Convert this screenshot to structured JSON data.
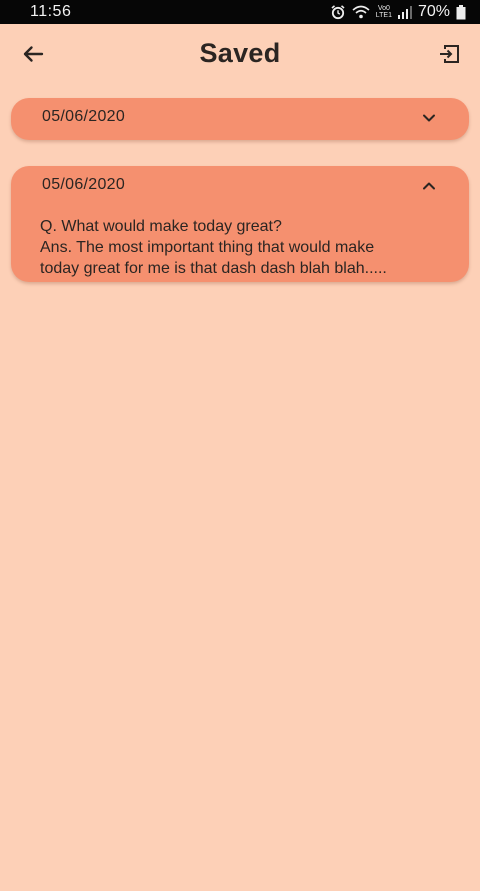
{
  "status_bar": {
    "time": "11:56",
    "network_top": "Vo0",
    "network_bottom": "LTE1",
    "battery": "70%"
  },
  "header": {
    "title": "Saved",
    "back_icon": "arrow-left-icon",
    "exit_icon": "logout-icon"
  },
  "entries": [
    {
      "date": "05/06/2020",
      "expanded": false,
      "toggle_icon": "chevron-down-icon"
    },
    {
      "date": "05/06/2020",
      "expanded": true,
      "toggle_icon": "chevron-up-icon",
      "question": "Q. What would make today great?",
      "answer_line_1": "Ans. The most important thing that would make",
      "answer_line_2": "today great for me is that dash dash blah blah....."
    }
  ],
  "colors": {
    "background": "#FDD0B7",
    "card": "#F5906F",
    "status_bar": "#060606",
    "text": "#2B2522"
  }
}
